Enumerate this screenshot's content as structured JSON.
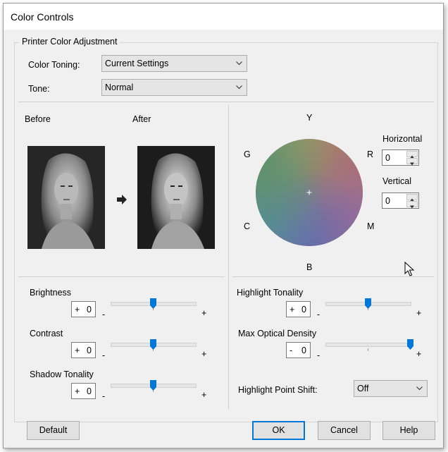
{
  "window": {
    "title": "Color Controls"
  },
  "group": {
    "label": "Printer Color Adjustment"
  },
  "color_toning": {
    "label": "Color Toning:",
    "value": "Current Settings"
  },
  "tone": {
    "label": "Tone:",
    "value": "Normal"
  },
  "preview": {
    "before_label": "Before",
    "after_label": "After"
  },
  "color_wheel": {
    "labels": {
      "y": "Y",
      "r": "R",
      "m": "M",
      "b": "B",
      "c": "C",
      "g": "G"
    },
    "horizontal": {
      "label": "Horizontal",
      "value": "0"
    },
    "vertical": {
      "label": "Vertical",
      "value": "0"
    }
  },
  "left_sliders": [
    {
      "label": "Brightness",
      "sign": "+",
      "value": "0",
      "minus": "-",
      "plus": "+",
      "level": 0.5
    },
    {
      "label": "Contrast",
      "sign": "+",
      "value": "0",
      "minus": "-",
      "plus": "+",
      "level": 0.5
    },
    {
      "label": "Shadow Tonality",
      "sign": "+",
      "value": "0",
      "minus": "-",
      "plus": "+",
      "level": 0.5
    }
  ],
  "right_sliders": [
    {
      "label": "Highlight Tonality",
      "sign": "+",
      "value": "0",
      "minus": "-",
      "plus": "+",
      "level": 0.5
    },
    {
      "label": "Max Optical Density",
      "sign": "-",
      "value": "0",
      "minus": "-",
      "plus": "+",
      "level": 1.0
    }
  ],
  "highlight_point_shift": {
    "label": "Highlight Point Shift:",
    "value": "Off"
  },
  "buttons": {
    "default": "Default",
    "ok": "OK",
    "cancel": "Cancel",
    "help": "Help"
  },
  "colors": {
    "accent": "#0078d7",
    "window_bg": "#f0f0f0",
    "button_bg": "#e1e1e1"
  }
}
